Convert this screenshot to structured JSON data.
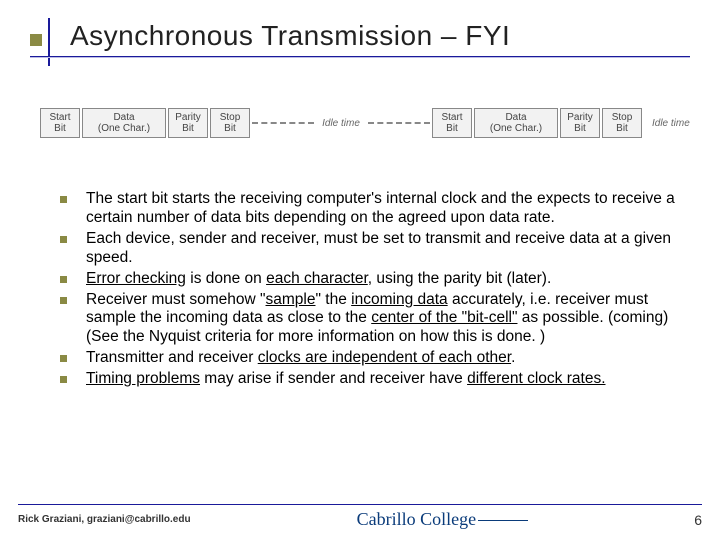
{
  "title": "Asynchronous Transmission – FYI",
  "diagram": {
    "frame1": {
      "start": {
        "l1": "Start",
        "l2": "Bit"
      },
      "data": {
        "l1": "Data",
        "l2": "(One Char.)"
      },
      "parity": {
        "l1": "Parity",
        "l2": "Bit"
      },
      "stop": {
        "l1": "Stop",
        "l2": "Bit"
      }
    },
    "idle_label": "Idle time",
    "frame2": {
      "start": {
        "l1": "Start",
        "l2": "Bit"
      },
      "data": {
        "l1": "Data",
        "l2": "(One Char.)"
      },
      "parity": {
        "l1": "Parity",
        "l2": "Bit"
      },
      "stop": {
        "l1": "Stop",
        "l2": "Bit"
      }
    },
    "idle_label2": "Idle time"
  },
  "bullets": {
    "b1_pre": "The start bit starts the receiving computer's internal clock and the expects to receive a certain number of data bits depending on the agreed upon data rate.",
    "b2_pre": "Each device, sender and receiver, must be set to transmit and receive data at a given speed.",
    "b3_u1": "Error checking",
    "b3_mid": " is done on ",
    "b3_u2": "each character",
    "b3_post": ", using the parity bit (later).",
    "b4_pre": "Receiver must somehow \"",
    "b4_u1": "sample",
    "b4_mid1": "\" the ",
    "b4_u2": "incoming data",
    "b4_mid2": " accurately, i.e. receiver must sample the incoming data as close to the ",
    "b4_u3": "center of the \"bit-cell\"",
    "b4_post": " as possible.   (coming)  (See the Nyquist criteria for more information on how this is done. )",
    "b5_pre": "Transmitter and receiver ",
    "b5_u1": "clocks are independent of each other",
    "b5_post": ".",
    "b6_u1": "Timing problems",
    "b6_mid": " may arise if sender and receiver have ",
    "b6_u2": "different clock rates.",
    "b6_post": ""
  },
  "footer": {
    "author": "Rick Graziani, graziani@cabrillo.edu",
    "logo": "Cabrillo College",
    "page": "6"
  }
}
